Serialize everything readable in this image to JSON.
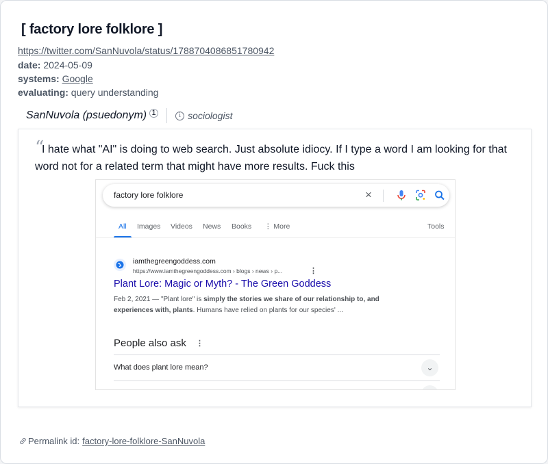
{
  "header": {
    "title": "[ factory lore folklore ]",
    "url": "https://twitter.com/SanNuvola/status/1788704086851780942",
    "date_label": "date:",
    "date_value": "2024-05-09",
    "systems_label": "systems:",
    "systems_value": "Google",
    "evaluating_label": "evaluating:",
    "evaluating_value": "query understanding"
  },
  "author": {
    "name": "SanNuvola (psuedonym)",
    "footnote": "1",
    "info_icon": "i",
    "role": "sociologist"
  },
  "quote": {
    "mark": "“",
    "text": "I hate what \"AI\" is doing to web search. Just absolute idiocy. If I type a word I am looking for that word not for a related term that might have more results. Fuck this"
  },
  "screenshot": {
    "search_query": "factory lore folklore",
    "clear_icon": "×",
    "tabs": [
      "All",
      "Images",
      "Videos",
      "News",
      "Books",
      "⋮ More"
    ],
    "tools_label": "Tools",
    "result": {
      "site_name": "iamthegreengoddess.com",
      "site_url": "https://www.iamthegreengoddess.com › blogs › news › p...",
      "kebab": "⋮",
      "title": "Plant Lore: Magic or Myth? - The Green Goddess",
      "snippet_date": "Feb 2, 2021 — ",
      "snippet_part1": "\"Plant lore\" is ",
      "snippet_bold1": "simply the stories we share of our relationship to, and experiences with, plants",
      "snippet_part2": ". Humans have relied on plants for our species' ..."
    },
    "paa": {
      "title": "People also ask",
      "kebab": "⋮",
      "question": "What does plant lore mean?",
      "chevron": "⌄"
    }
  },
  "footer": {
    "permalink_label": "Permalink id:",
    "permalink_id": "factory-lore-folklore-SanNuvola"
  },
  "colors": {
    "google_blue": "#1a73e8",
    "result_link": "#1a0dab"
  }
}
